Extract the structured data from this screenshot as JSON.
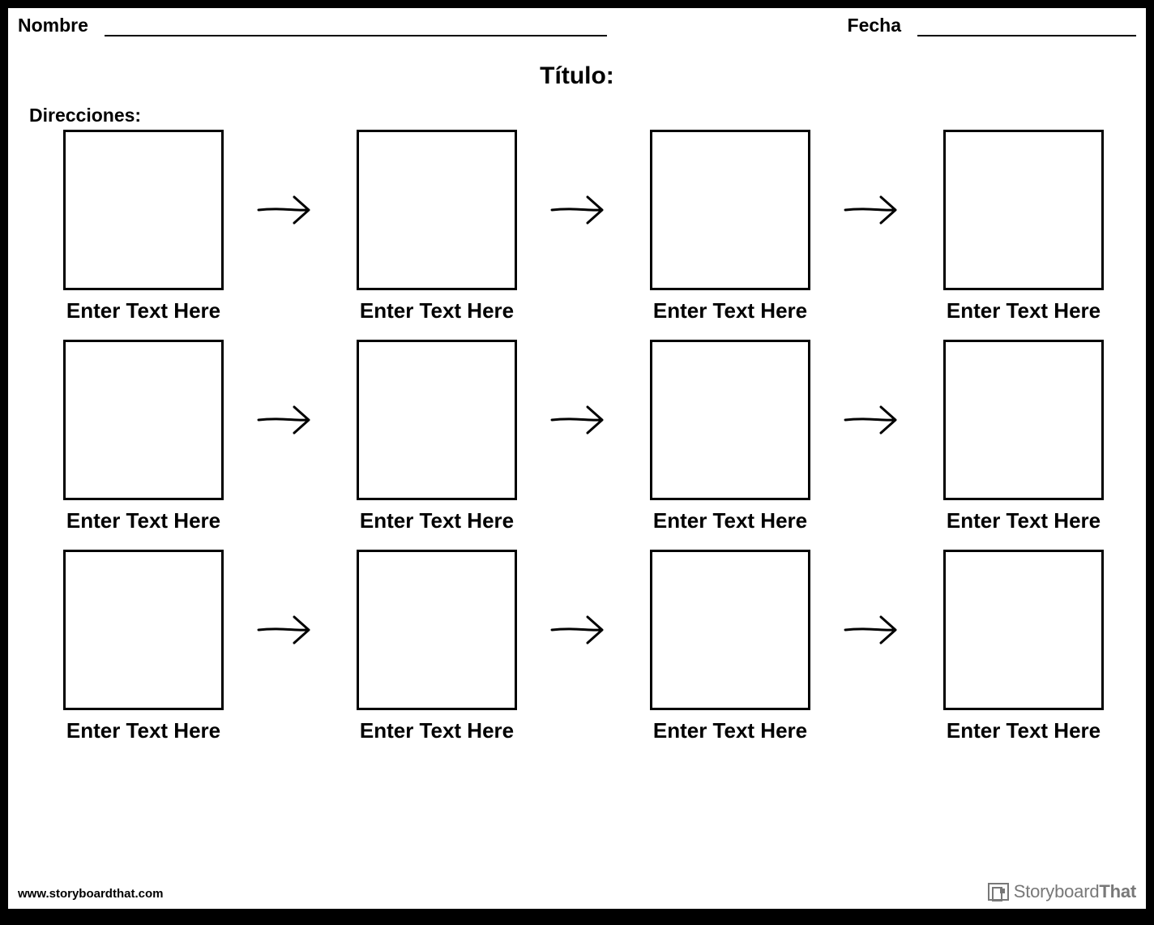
{
  "header": {
    "name_label": "Nombre",
    "date_label": "Fecha"
  },
  "title": "Título:",
  "directions_label": "Direcciones:",
  "rows": [
    {
      "cells": [
        {
          "caption": "Enter Text Here"
        },
        {
          "caption": "Enter Text Here"
        },
        {
          "caption": "Enter Text Here"
        },
        {
          "caption": "Enter Text Here"
        }
      ]
    },
    {
      "cells": [
        {
          "caption": "Enter Text Here"
        },
        {
          "caption": "Enter Text Here"
        },
        {
          "caption": "Enter Text Here"
        },
        {
          "caption": "Enter Text Here"
        }
      ]
    },
    {
      "cells": [
        {
          "caption": "Enter Text Here"
        },
        {
          "caption": "Enter Text Here"
        },
        {
          "caption": "Enter Text Here"
        },
        {
          "caption": "Enter Text Here"
        }
      ]
    }
  ],
  "footer": {
    "url": "www.storyboardthat.com",
    "brand_thin": "Storyboard",
    "brand_bold": "That"
  }
}
